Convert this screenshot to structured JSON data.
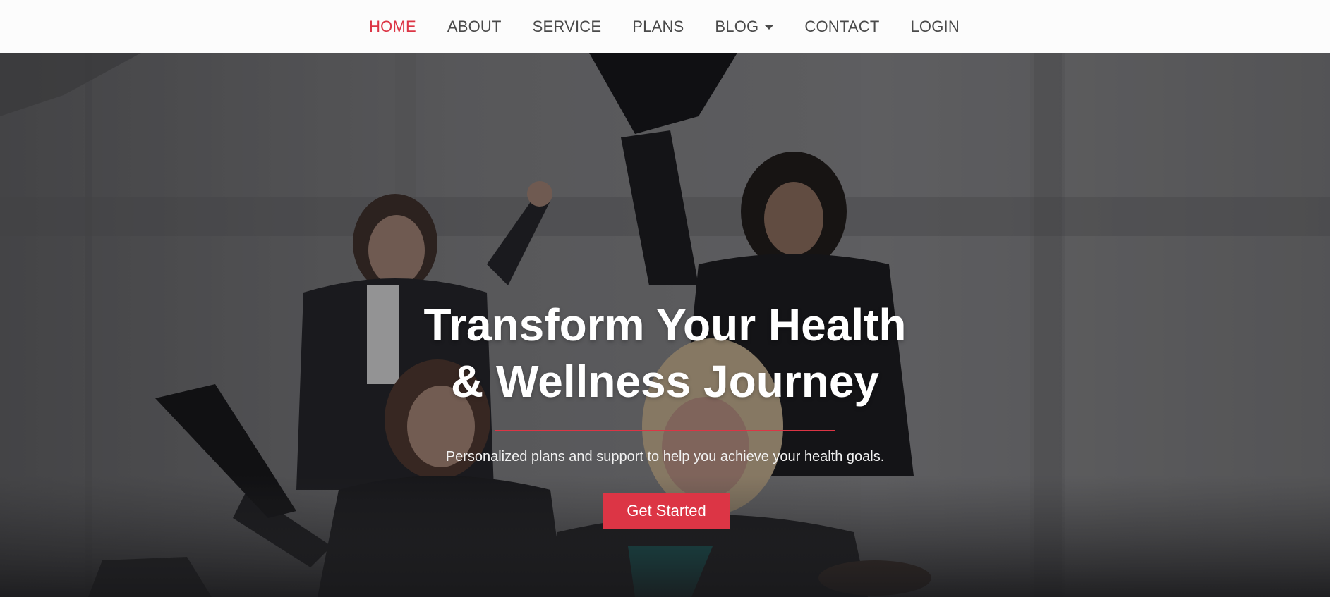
{
  "nav": {
    "items": [
      {
        "label": "HOME",
        "active": true
      },
      {
        "label": "ABOUT"
      },
      {
        "label": "SERVICE"
      },
      {
        "label": "PLANS"
      },
      {
        "label": "BLOG",
        "dropdown": true
      },
      {
        "label": "CONTACT"
      },
      {
        "label": "LOGIN"
      }
    ]
  },
  "hero": {
    "title_line1": "Transform Your Health",
    "title_line2": "& Wellness Journey",
    "subtitle": "Personalized plans and support to help you achieve your health goals.",
    "cta_label": "Get Started",
    "background_image": "photo of four celebrating businesswomen in an office"
  },
  "colors": {
    "accent": "#dc3545",
    "nav_text": "#4a4a4a",
    "nav_background": "#fcfcfc"
  }
}
